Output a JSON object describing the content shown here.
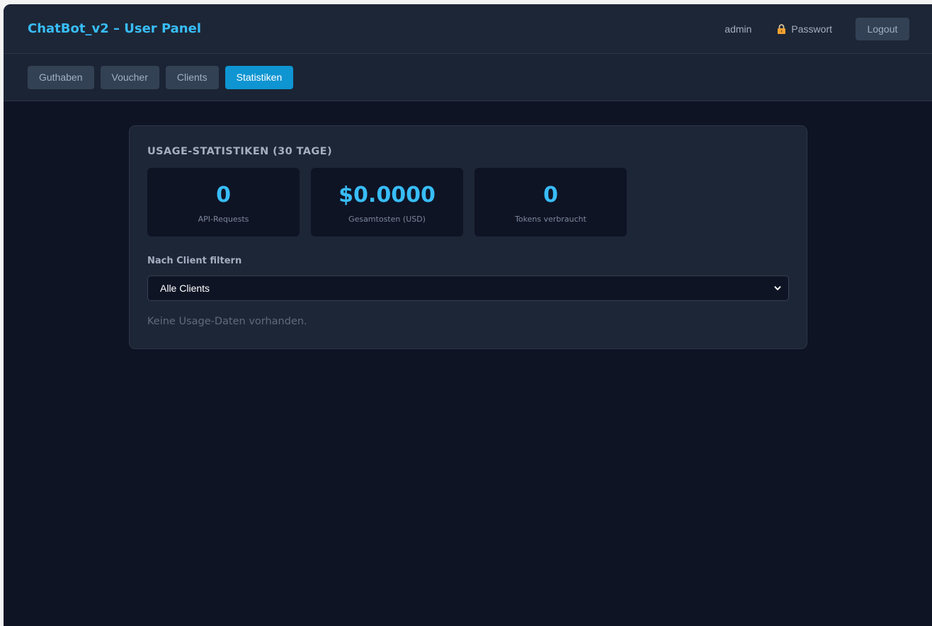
{
  "header": {
    "title": "ChatBot_v2 – User Panel",
    "username": "admin",
    "password_link": "Passwort",
    "logout_label": "Logout"
  },
  "tabs": [
    {
      "label": "Guthaben",
      "active": false
    },
    {
      "label": "Voucher",
      "active": false
    },
    {
      "label": "Clients",
      "active": false
    },
    {
      "label": "Statistiken",
      "active": true
    }
  ],
  "stats_card": {
    "title": "USAGE-STATISTIKEN (30 TAGE)",
    "stats": [
      {
        "value": "0",
        "label": "API-Requests"
      },
      {
        "value": "$0.0000",
        "label": "Gesamtosten (USD)"
      },
      {
        "value": "0",
        "label": "Tokens verbraucht"
      }
    ],
    "filter_label": "Nach Client filtern",
    "filter_selected": "Alle Clients",
    "empty_message": "Keine Usage-Daten vorhanden."
  },
  "icons": {
    "password": "lock-icon",
    "select_arrow": "chevron-down-icon"
  },
  "colors": {
    "accent": "#38bdf8",
    "active_tab": "#0e95d2",
    "background": "#0f1425",
    "panel": "#1d2636"
  }
}
